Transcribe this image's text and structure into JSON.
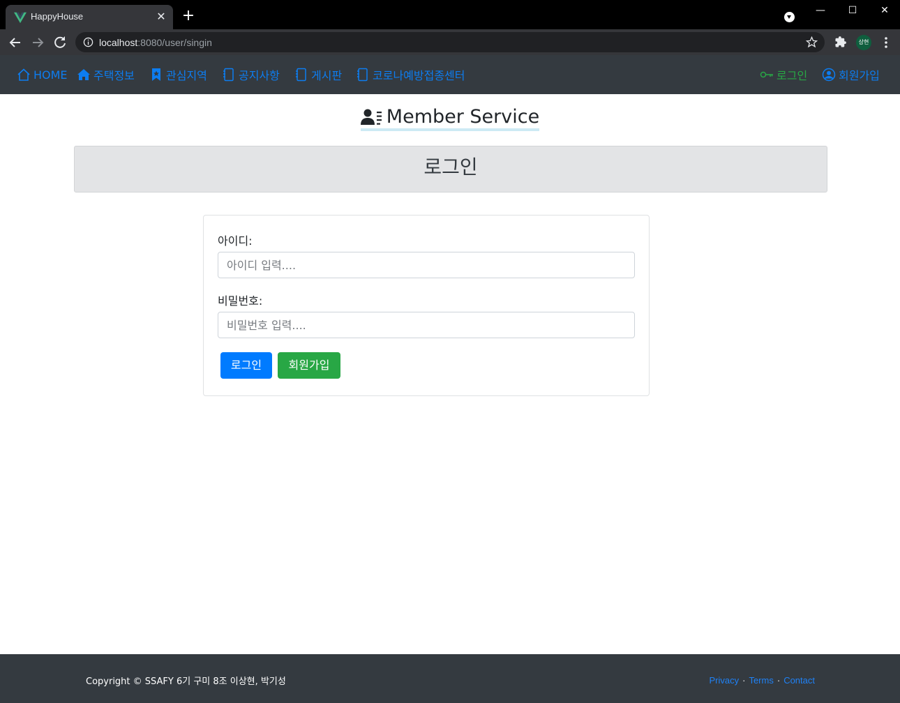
{
  "browser": {
    "tab_title": "HappyHouse",
    "tab_close": "✕",
    "new_tab": "+",
    "url_host": "localhost",
    "url_path": ":8080/user/singin",
    "profile_initials": "상현",
    "window_controls": {
      "minimize": "—",
      "maximize": "☐",
      "close": "✕"
    },
    "icons": [
      "vue-logo-icon",
      "back-arrow-icon",
      "forward-arrow-icon",
      "reload-icon",
      "info-icon",
      "star-icon",
      "extensions-icon",
      "kebab-menu-icon"
    ]
  },
  "navbar": {
    "left_items": [
      {
        "label": "HOME",
        "icon": "house-outline-icon"
      },
      {
        "label": "주택정보",
        "icon": "house-fill-icon"
      },
      {
        "label": "관심지역",
        "icon": "bookmark-icon"
      },
      {
        "label": "공지사항",
        "icon": "journal-icon"
      },
      {
        "label": "게시판",
        "icon": "journal-icon"
      },
      {
        "label": "코로나예방접종센터",
        "icon": "journal-icon"
      }
    ],
    "right_items": [
      {
        "label": "로그인",
        "icon": "key-icon"
      },
      {
        "label": "회원가입",
        "icon": "person-circle-icon"
      }
    ]
  },
  "page": {
    "title": "Member Service",
    "jumbotron": "로그인"
  },
  "form": {
    "id_label": "아이디:",
    "id_placeholder": "아이디 입력....",
    "pw_label": "비밀번호:",
    "pw_placeholder": "비밀번호 입력....",
    "login_button": "로그인",
    "signup_button": "회원가입"
  },
  "footer": {
    "copyright": "Copyright © SSAFY 6기 구미 8조 이상현, 박기성",
    "links": [
      "Privacy",
      "Terms",
      "Contact"
    ],
    "separator": "·"
  },
  "colors": {
    "navbar_bg": "#343a40",
    "link_blue": "#0d7df0",
    "success_green": "#28a745",
    "primary_blue": "#007bff",
    "jumbotron_bg": "#e3e4e6"
  }
}
